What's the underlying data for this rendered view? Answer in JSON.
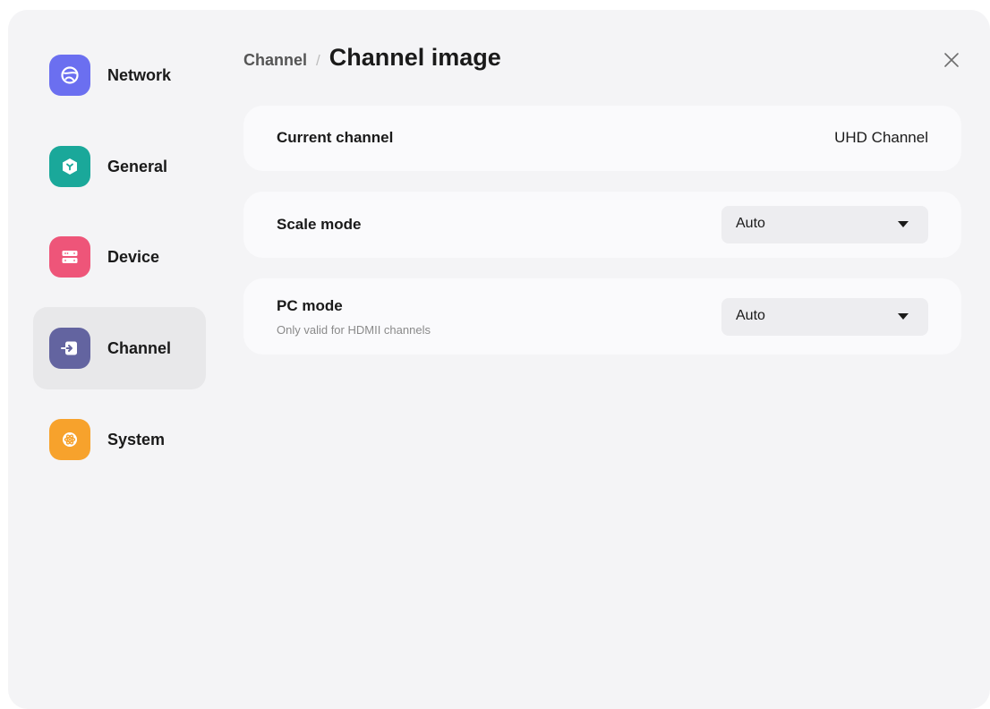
{
  "sidebar": {
    "items": [
      {
        "label": "Network",
        "icon": "globe-icon",
        "color": "#6b6ff0",
        "active": false
      },
      {
        "label": "General",
        "icon": "cube-icon",
        "color": "#1aa89a",
        "active": false
      },
      {
        "label": "Device",
        "icon": "server-icon",
        "color": "#ee5579",
        "active": false
      },
      {
        "label": "Channel",
        "icon": "input-icon",
        "color": "#6364a0",
        "active": true
      },
      {
        "label": "System",
        "icon": "atom-icon",
        "color": "#f7a22c",
        "active": false
      }
    ]
  },
  "header": {
    "breadcrumb_parent": "Channel",
    "breadcrumb_separator": "/",
    "title": "Channel image"
  },
  "settings": {
    "current_channel": {
      "label": "Current channel",
      "value": "UHD Channel"
    },
    "scale_mode": {
      "label": "Scale mode",
      "value": "Auto"
    },
    "pc_mode": {
      "label": "PC mode",
      "sublabel": "Only valid for HDMII channels",
      "value": "Auto"
    }
  }
}
